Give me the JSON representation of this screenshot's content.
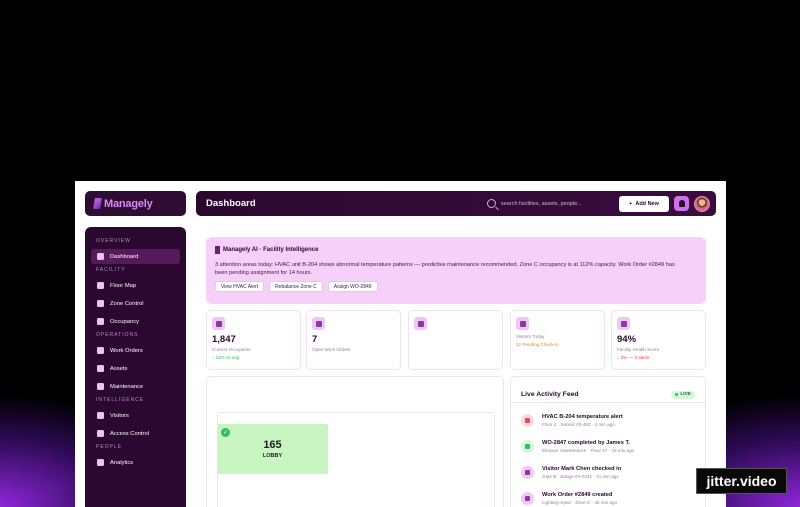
{
  "brand": {
    "name": "Managely"
  },
  "header": {
    "title": "Dashboard",
    "search_placeholder": "search facilities, assets, people...",
    "add_label": "Add New"
  },
  "sidebar": {
    "sections": [
      {
        "title": "OVERVIEW",
        "items": [
          {
            "label": "Dashboard",
            "icon": "grid-icon",
            "active": true
          }
        ]
      },
      {
        "title": "FACILITY",
        "items": [
          {
            "label": "Floor Map",
            "icon": "map-icon"
          },
          {
            "label": "Zone Control",
            "icon": "gear-icon"
          },
          {
            "label": "Occupancy",
            "icon": "monitor-icon"
          }
        ]
      },
      {
        "title": "OPERATIONS",
        "items": [
          {
            "label": "Work Orders",
            "icon": "clipboard-icon"
          },
          {
            "label": "Assets",
            "icon": "box-icon"
          },
          {
            "label": "Maintenance",
            "icon": "wrench-icon"
          }
        ]
      },
      {
        "title": "INTELLIGENCE",
        "items": [
          {
            "label": "Visitors",
            "icon": "eye-icon"
          },
          {
            "label": "Access Control",
            "icon": "lock-icon"
          }
        ]
      },
      {
        "title": "PEOPLE",
        "items": [
          {
            "label": "Analytics",
            "icon": "chart-icon"
          }
        ]
      }
    ]
  },
  "ai_banner": {
    "title": "Managely AI · Facility Intelligence",
    "text": "3 attention areas today: HVAC unit B-204 shows abnormal temperature patterns — predictive maintenance recommended. Zone C occupancy is at 112% capacity. Work Order #2849 has been pending assignment for 14 hours.",
    "actions": [
      "View HVAC Alert",
      "Rebalance Zone C",
      "Assign WO-2849"
    ]
  },
  "stats": [
    {
      "value": "1,847",
      "label": "Current Occupants",
      "note": "↑ 12% vs avg",
      "note_color": "#2ec05a"
    },
    {
      "value": "7",
      "label": "Open Work Orders",
      "note": "",
      "note_color": "#2ec05a"
    },
    {
      "value": "",
      "label": "",
      "note": "",
      "note_color": "#2ec05a"
    },
    {
      "value": "",
      "label": "Visitors Today",
      "note": "12 Pending Check-in",
      "note_color": "#e08a1e"
    },
    {
      "value": "94%",
      "label": "Facility Health Score",
      "note": "↓ 3% — 3 alerts",
      "note_color": "#e04a4a"
    }
  ],
  "map": {
    "zone_value": "165",
    "zone_name": "LOBBY"
  },
  "feed": {
    "title": "Live Activity Feed",
    "badge": "LIVE",
    "items": [
      {
        "title": "HVAC B-204 temperature alert",
        "sub": "Floor 2 · Sensor #3-482 · 2 min ago",
        "bg": "#fbd9dc",
        "fg": "#e04a5a"
      },
      {
        "title": "WO-2847 completed by James T.",
        "sub": "Elevator maintenance · Floor 17 · 18 min ago",
        "bg": "#d6f7dd",
        "fg": "#2ec05a"
      },
      {
        "title": "Visitor Mark Chen checked in",
        "sub": "Gate B · Badge #V-0241 · 31 min ago",
        "bg": "#f1c6f6",
        "fg": "#8d3aa0"
      },
      {
        "title": "Work Order #2849 created",
        "sub": "Lighting repair · Zone C · 45 min ago",
        "bg": "#f1c6f6",
        "fg": "#8d3aa0"
      }
    ]
  },
  "watermark": "jitter.video"
}
